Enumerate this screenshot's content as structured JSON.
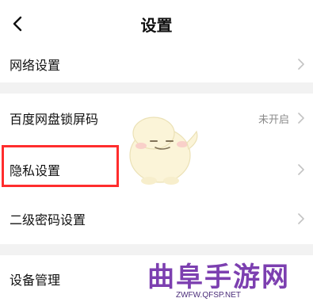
{
  "header": {
    "title": "设置",
    "back_icon": "chevron-left-icon"
  },
  "rows": [
    {
      "label": "网络设置",
      "icon": "chevron-right-icon"
    },
    {
      "label": "百度网盘锁屏码",
      "status": "未开启",
      "icon": "chevron-right-icon"
    },
    {
      "label": "隐私设置",
      "icon": "chevron-right-icon"
    },
    {
      "label": "二级密码设置",
      "icon": "chevron-right-icon"
    },
    {
      "label": "设备管理"
    }
  ],
  "watermark": {
    "text": "曲阜手游网",
    "url": "ZWFW.QFSP.NET"
  },
  "colors": {
    "highlight": "#ff2d2d",
    "separator": "#f2f2f2",
    "status_text": "#8a8a8a",
    "chevron": "#c2c2c2",
    "watermark": "#7c3fb0"
  }
}
